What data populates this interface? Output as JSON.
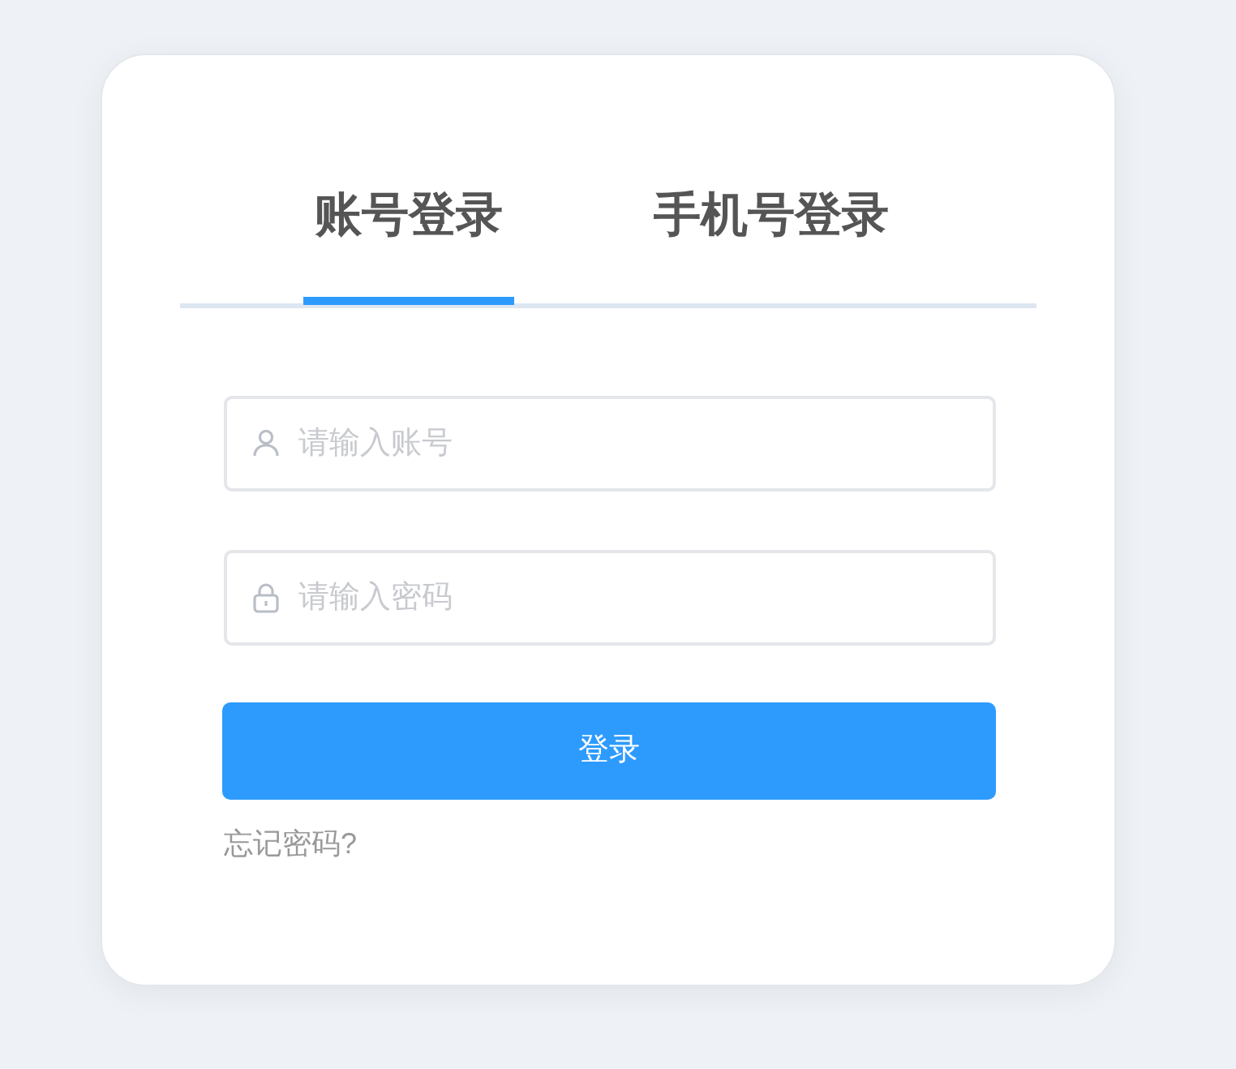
{
  "tabs": [
    {
      "label": "账号登录",
      "selected": true
    },
    {
      "label": "手机号登录",
      "selected": false
    }
  ],
  "fields": [
    {
      "kind": "user",
      "placeholder": "请输入账号"
    },
    {
      "kind": "password",
      "placeholder": "请输入密码"
    }
  ],
  "login_button": "登录",
  "forgot_link": "忘记密码?"
}
